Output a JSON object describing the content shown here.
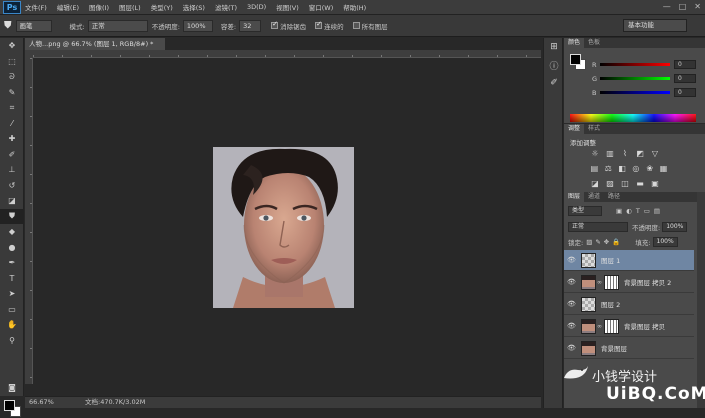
{
  "app": {
    "logo": "Ps"
  },
  "menu": [
    "文件(F)",
    "编辑(E)",
    "图像(I)",
    "图层(L)",
    "类型(Y)",
    "选择(S)",
    "滤镜(T)",
    "3D(D)",
    "视图(V)",
    "窗口(W)",
    "帮助(H)"
  ],
  "window_controls": [
    "—",
    "□",
    "✕"
  ],
  "options": {
    "tool_preset": "画笔",
    "mode_label": "模式:",
    "mode_value": "正常",
    "opacity_label": "不透明度:",
    "opacity_value": "100%",
    "tolerance_label": "容差:",
    "tolerance_value": "32",
    "antialias_label": "消除锯齿",
    "contiguous_label": "连续的",
    "all_layers_label": "所有图层",
    "workspace": "基本功能"
  },
  "document": {
    "tab_title": "人物...png @ 66.7% (图层 1, RGB/8#) *",
    "zoom": "66.67%",
    "doc_size": "文档:470.7K/3.02M"
  },
  "colors_panel": {
    "tabs": [
      "颜色",
      "色板"
    ],
    "r_label": "R",
    "g_label": "G",
    "b_label": "B",
    "r_value": "0",
    "g_value": "0",
    "b_value": "0"
  },
  "adjustments_panel": {
    "tabs": [
      "调整",
      "样式"
    ],
    "title": "添加调整"
  },
  "layers_panel": {
    "tabs": [
      "图层",
      "通道",
      "路径"
    ],
    "filter_kind": "类型",
    "blend_mode": "正常",
    "opacity_label": "不透明度:",
    "opacity_value": "100%",
    "lock_label": "锁定:",
    "fill_label": "填充:",
    "fill_value": "100%",
    "layers": [
      {
        "name": "图层 1",
        "selected": true
      },
      {
        "name": "背景图层 拷贝 2",
        "selected": false
      },
      {
        "name": "图层 2",
        "selected": false
      },
      {
        "name": "背景图层 拷贝",
        "selected": false
      },
      {
        "name": "背景图层",
        "selected": false
      }
    ]
  },
  "watermark": {
    "title": "小钱学设计",
    "site": "UiBQ.CoM"
  }
}
